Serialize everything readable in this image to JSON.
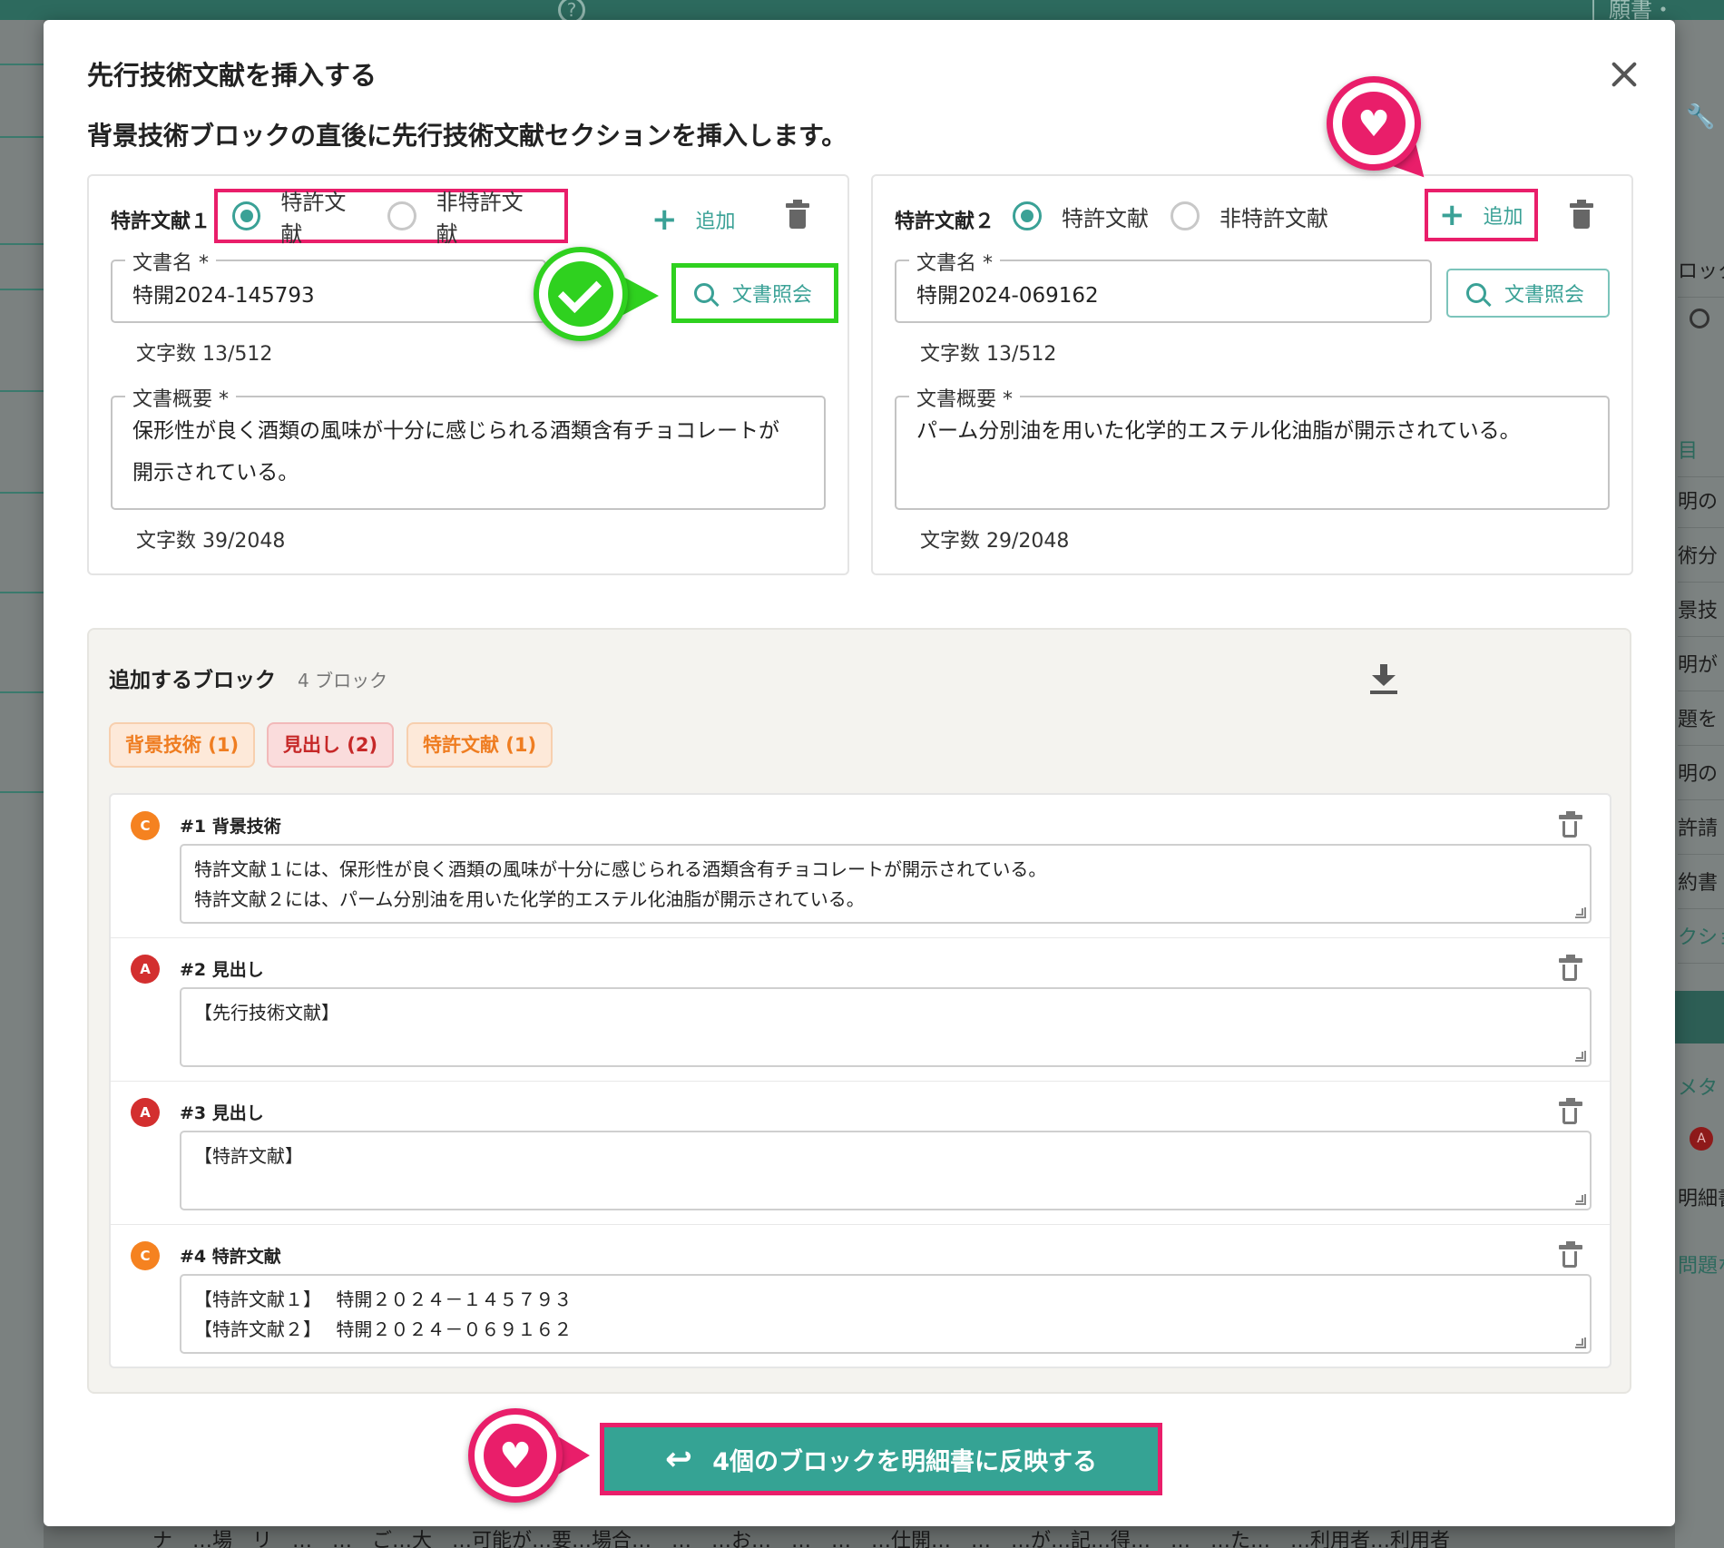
{
  "background": {
    "top_tab_label": "願書・",
    "right_items": [
      "ロック",
      "目",
      "明の",
      "術分",
      "景技",
      "明が",
      "題を",
      "明の",
      "許請",
      "約書",
      "クショ",
      "メタ",
      "明細書",
      "問題な"
    ],
    "right_badge": "A",
    "bottom_text": "ナ　…場　リ　…　…　ご…大　…可能が…要…場合…　…　…お…　…　…　…仕開…　…　…が…記…得…　…　…た…　…利用者…利用者"
  },
  "modal": {
    "title": "先行技術文献を挿入する",
    "description": "背景技術ブロックの直後に先行技術文献セクションを挿入します。"
  },
  "documents": [
    {
      "label": "特許文献１",
      "radio_patent": "特許文献",
      "radio_nonpatent": "非特許文献",
      "selected": "patent",
      "add_label": "追加",
      "name_legend": "文書名 *",
      "name_value": "特開2024-145793",
      "lookup_label": "文書照会",
      "name_counter": "文字数 13/512",
      "summary_legend": "文書概要 *",
      "summary_value": "保形性が良く酒類の風味が十分に感じられる酒類含有チョコレートが開示されている。",
      "summary_counter": "文字数 39/2048"
    },
    {
      "label": "特許文献２",
      "radio_patent": "特許文献",
      "radio_nonpatent": "非特許文献",
      "selected": "patent",
      "add_label": "追加",
      "name_legend": "文書名 *",
      "name_value": "特開2024-069162",
      "lookup_label": "文書照会",
      "name_counter": "文字数 13/512",
      "summary_legend": "文書概要 *",
      "summary_value": "パーム分別油を用いた化学的エステル化油脂が開示されている。",
      "summary_counter": "文字数 29/2048"
    }
  ],
  "blocks_panel": {
    "title": "追加するブロック",
    "count": "4 ブロック",
    "chips": [
      {
        "label": "背景技術 (1)",
        "color": "#ef7d21"
      },
      {
        "label": "見出し (2)",
        "color": "#c62828"
      },
      {
        "label": "特許文献 (1)",
        "color": "#ef7d21"
      }
    ],
    "blocks": [
      {
        "badge": "C",
        "title": "#1 背景技術",
        "text": "特許文献１には、保形性が良く酒類の風味が十分に感じられる酒類含有チョコレートが開示されている。\n特許文献２には、パーム分別油を用いた化学的エステル化油脂が開示されている。"
      },
      {
        "badge": "A",
        "title": "#2 見出し",
        "text": "【先行技術文献】"
      },
      {
        "badge": "A",
        "title": "#3 見出し",
        "text": "【特許文献】"
      },
      {
        "badge": "C",
        "title": "#4 特許文献",
        "text": "【特許文献１】　 特開２０２４－１４５７９３\n【特許文献２】　 特開２０２４－０６９１６２"
      }
    ]
  },
  "apply_button": {
    "label": "4個のブロックを明細書に反映する"
  },
  "colors": {
    "accent": "#3aa196",
    "highlight_pink": "#e91e6a",
    "highlight_green": "#2fd11f",
    "badge_c": "#f58220",
    "badge_a": "#d32f2f"
  },
  "icons": {
    "close": "close-icon",
    "add": "plus-icon",
    "delete": "trash-icon",
    "lookup": "search-icon",
    "download": "download-icon",
    "apply": "reply-arrow-icon",
    "callout_heart": "heart-icon",
    "callout_check": "check-icon"
  }
}
